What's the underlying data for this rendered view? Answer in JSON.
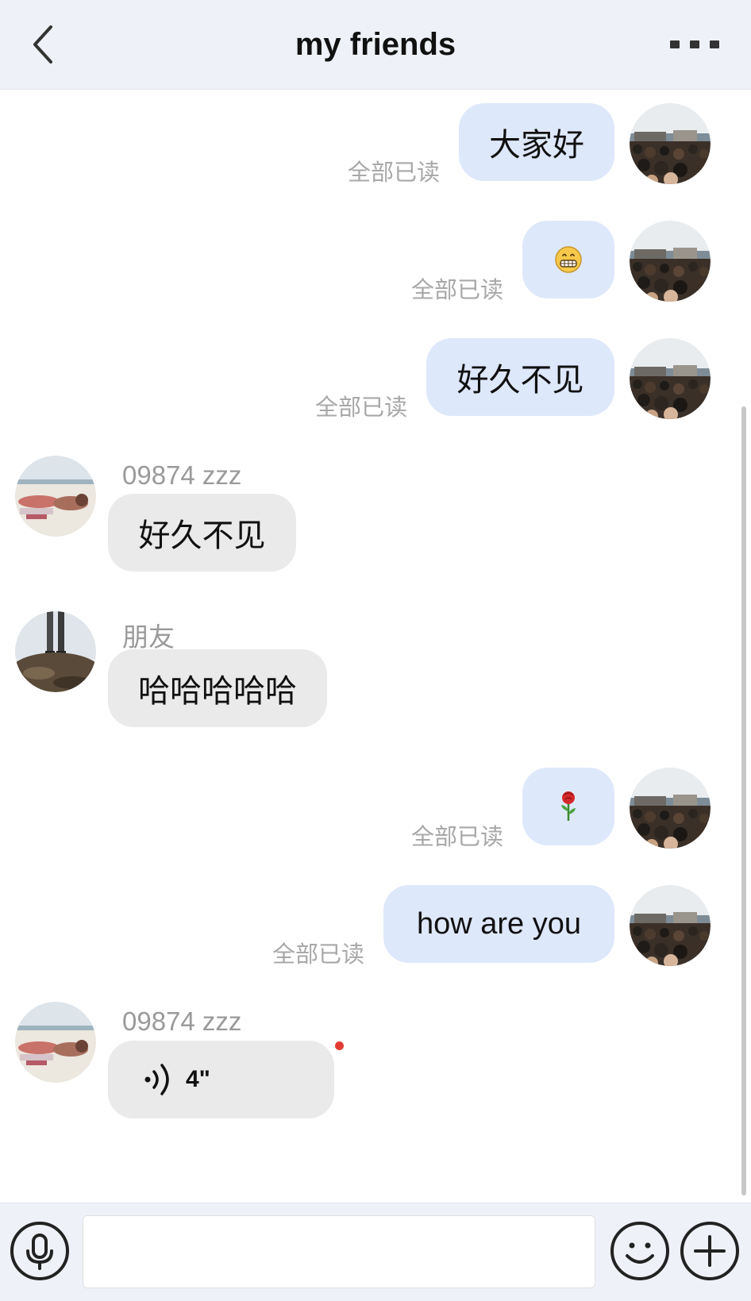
{
  "header": {
    "title": "my friends"
  },
  "read_status": "全部已读",
  "messages": [
    {
      "side": "mine",
      "text": "大家好",
      "read": "全部已读"
    },
    {
      "side": "mine",
      "emoji": "grinning-face",
      "read": "全部已读"
    },
    {
      "side": "mine",
      "text": "好久不见",
      "read": "全部已读"
    },
    {
      "side": "theirs",
      "sender": "09874 zzz",
      "text": "好久不见"
    },
    {
      "side": "theirs",
      "sender": "朋友",
      "text": "哈哈哈哈哈"
    },
    {
      "side": "mine",
      "emoji": "rose",
      "read": "全部已读"
    },
    {
      "side": "mine",
      "text": "how are you",
      "read": "全部已读"
    },
    {
      "side": "theirs",
      "sender": "09874 zzz",
      "voice_duration": "4\"",
      "unplayed": true
    }
  ],
  "input": {
    "placeholder": ""
  },
  "icons": [
    "back-arrow-icon",
    "more-icon",
    "microphone-icon",
    "smiley-icon",
    "plus-icon"
  ],
  "colors": {
    "my_bubble": "#dee8fb",
    "their_bubble": "#eaeaea",
    "header_bg": "#eef1f7",
    "unread_dot": "#e23b32"
  }
}
